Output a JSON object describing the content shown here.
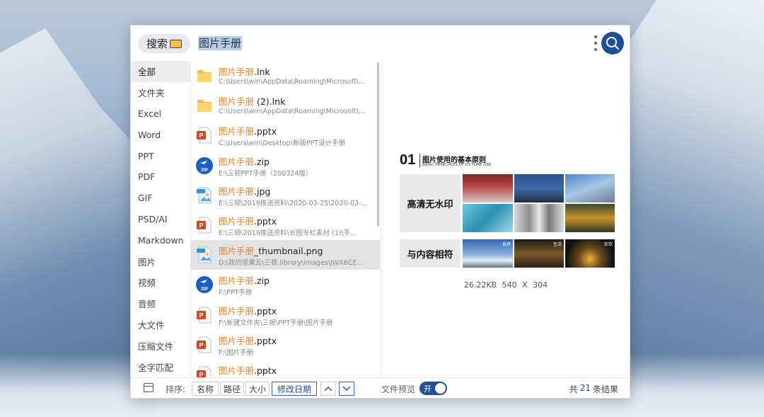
{
  "search": {
    "scope_label": "搜索",
    "query": "图片手册"
  },
  "sidebar": {
    "items": [
      {
        "label": "全部",
        "active": true
      },
      {
        "label": "文件夹"
      },
      {
        "label": "Excel"
      },
      {
        "label": "Word"
      },
      {
        "label": "PPT"
      },
      {
        "label": "PDF"
      },
      {
        "label": "GIF"
      },
      {
        "label": "PSD/AI"
      },
      {
        "label": "Markdown"
      },
      {
        "label": "图片"
      },
      {
        "label": "视频"
      },
      {
        "label": "音频"
      },
      {
        "label": "大文件"
      },
      {
        "label": "压缩文件"
      },
      {
        "label": "全字匹配"
      }
    ]
  },
  "files": [
    {
      "match": "图片手册",
      "rest": ".lnk",
      "path": "C:\\Users\\win\\AppData\\Roaming\\Microsoft\\...",
      "icon": "folder-icon"
    },
    {
      "match": "图片手册",
      "rest": " (2).lnk",
      "path": "C:\\Users\\win\\AppData\\Roaming\\Microsoft\\...",
      "icon": "folder-icon"
    },
    {
      "match": "图片手册",
      "rest": ".pptx",
      "path": "C:\\Users\\win\\Desktop\\新版PPT设计手册",
      "icon": "pptx-icon"
    },
    {
      "match": "图片手册",
      "rest": ".zip",
      "path": "E:\\三顿PPT手册（200324版）",
      "icon": "zip-icon"
    },
    {
      "match": "图片手册",
      "rest": ".jpg",
      "path": "E:\\三顿\\2019推送资料\\2020-03-25\\2020-03-...",
      "icon": "image-icon"
    },
    {
      "match": "图片手册",
      "rest": ".pptx",
      "path": "E:\\三顿\\2019推送资料\\长图专栏素材 (1)\\手...",
      "icon": "pptx-icon"
    },
    {
      "match": "图片手册",
      "rest": "_thumbnail.png",
      "path": "D:\\我的坚果云\\三顿.library\\images\\JWX6CE...",
      "icon": "image-icon",
      "selected": true
    },
    {
      "match": "图片手册",
      "rest": ".zip",
      "path": "F:\\PPT手册",
      "icon": "zip-icon"
    },
    {
      "match": "图片手册",
      "rest": ".pptx",
      "path": "F:\\新建文件夹\\三顿\\PPT手册\\图片手册",
      "icon": "pptx-icon"
    },
    {
      "match": "图片手册",
      "rest": ".pptx",
      "path": "F:\\图片手册",
      "icon": "pptx-icon"
    },
    {
      "match": "图片手册",
      "rest": ".pptx",
      "path": "",
      "icon": "pptx-icon"
    }
  ],
  "preview": {
    "slide_number": "01",
    "slide_title": "图片使用的基本原则",
    "slide_subtitle": "BASIC PRINCIPLES OF PICTURE USE",
    "row1_label": "高清无水印",
    "row2_label": "与内容相符",
    "tags": [
      "自然",
      "生活",
      "狂欢"
    ],
    "file_size": "26.22KB",
    "dimensions": "540 X 304"
  },
  "bottom": {
    "sort_label": "排序:",
    "sort_options": [
      {
        "label": "名称"
      },
      {
        "label": "路径"
      },
      {
        "label": "大小"
      },
      {
        "label": "修改日期",
        "active": true
      }
    ],
    "preview_label": "文件预览",
    "toggle_label": "开",
    "result_prefix": "共",
    "result_count": "21",
    "result_suffix": "条结果"
  },
  "colors": {
    "accent": "#1f4f96",
    "match_highlight": "#e8832a"
  }
}
